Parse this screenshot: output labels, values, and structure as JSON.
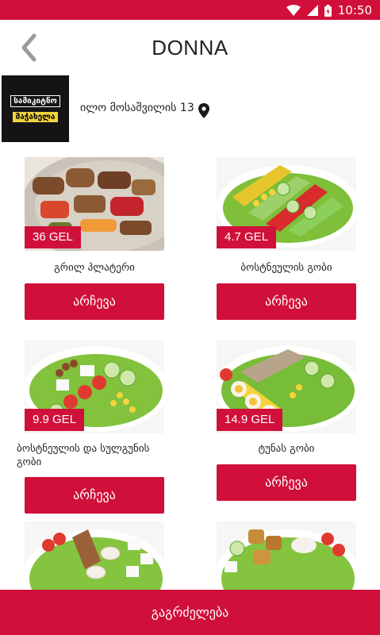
{
  "status_bar": {
    "time": "10:50"
  },
  "header": {
    "title": "DONNA",
    "back_icon": "chevron-left-icon"
  },
  "store": {
    "logo_line1": "სამიკიტნო",
    "logo_line2": "მაჭახელა",
    "address": "ილო მოსაშვილის 13",
    "location_icon": "map-pin-icon"
  },
  "products": [
    {
      "name": "გრილ პლატერი",
      "price": "36 GEL",
      "button": "არჩევა"
    },
    {
      "name": "ბოსტნეულის გობი",
      "price": "4.7 GEL",
      "button": "არჩევა"
    },
    {
      "name": "ბოსტნეულის და სულგუნის გობი",
      "price": "9.9 GEL",
      "button": "არჩევა"
    },
    {
      "name": "ტუნას გობი",
      "price": "14.9 GEL",
      "button": "არჩევა"
    }
  ],
  "footer": {
    "continue_label": "გაგრძელება"
  },
  "colors": {
    "accent": "#d0103a",
    "text": "#222222"
  }
}
